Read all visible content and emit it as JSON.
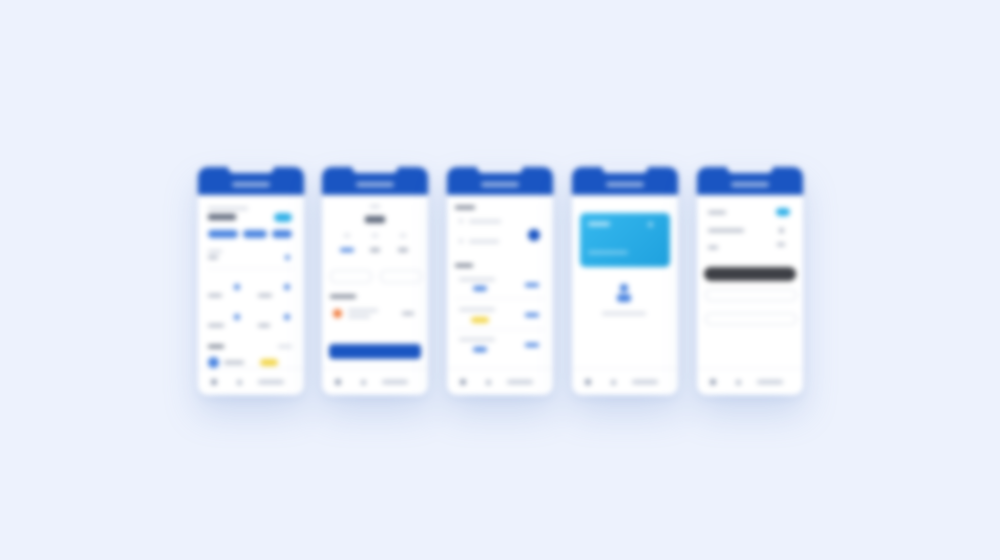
{
  "screens": [
    {
      "title": ""
    },
    {
      "title": "",
      "primary_button": ""
    },
    {
      "title": ""
    },
    {
      "title": "",
      "card_label": ""
    },
    {
      "title": "",
      "dark_button": "",
      "outline_button_1": "",
      "outline_button_2": ""
    }
  ],
  "colors": {
    "background": "#edf2fd",
    "header": "#1a55c2",
    "accent": "#2fb0e8",
    "card": "#2aaee6",
    "badge": "#f2d648",
    "alert": "#f07a3c",
    "dark_button": "#3d3f45"
  }
}
